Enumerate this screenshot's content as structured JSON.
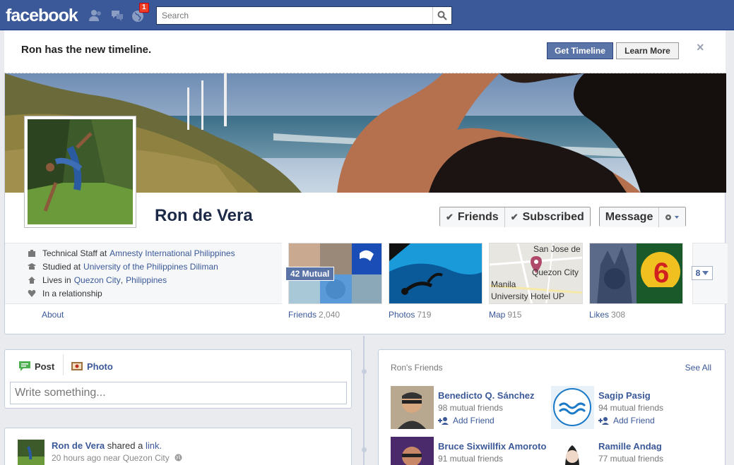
{
  "topbar": {
    "logo": "facebook",
    "notification_count": "1",
    "search_placeholder": "Search"
  },
  "banner": {
    "text": "Ron has the new timeline.",
    "get_timeline": "Get Timeline",
    "learn_more": "Learn More",
    "close": "×"
  },
  "profile": {
    "name": "Ron de Vera",
    "actions": {
      "friends": "Friends",
      "subscribed": "Subscribed",
      "message": "Message"
    },
    "info": [
      {
        "icon": "briefcase-icon",
        "prefix": "Technical Staff at",
        "link": "Amnesty International Philippines"
      },
      {
        "icon": "school-icon",
        "prefix": "Studied at",
        "link": "University of the Philippines Diliman"
      },
      {
        "icon": "home-icon",
        "prefix": "Lives in",
        "link": "Quezon City",
        "link2": "Philippines"
      },
      {
        "icon": "heart-icon",
        "prefix": "In a relationship"
      }
    ],
    "about": "About",
    "tiles": [
      {
        "label": "Friends",
        "count": "2,040",
        "overlay": "42 Mutual"
      },
      {
        "label": "Photos",
        "count": "719"
      },
      {
        "label": "Map",
        "count": "915",
        "map_labels": [
          "San Jose de",
          "Quezon City",
          "Manila",
          "University Hotel UP"
        ]
      },
      {
        "label": "Likes",
        "count": "308"
      }
    ],
    "more_count": "8"
  },
  "composer": {
    "post_tab": "Post",
    "photo_tab": "Photo",
    "placeholder": "Write something..."
  },
  "post": {
    "author": "Ron de Vera",
    "action": "shared a",
    "object": "link.",
    "meta": "20 hours ago near Quezon City"
  },
  "friends_box": {
    "title": "Ron's Friends",
    "see_all": "See All",
    "add_label": "Add Friend",
    "people": [
      {
        "name": "Benedicto Q. Sánchez",
        "mutual": "98 mutual friends"
      },
      {
        "name": "Sagip Pasig",
        "mutual": "94 mutual friends"
      },
      {
        "name": "Bruce Sixwillfix Amoroto",
        "mutual": "91 mutual friends"
      },
      {
        "name": "Ramille Andag",
        "mutual": "77 mutual friends"
      }
    ]
  },
  "colors": {
    "brand": "#3b5998",
    "brand_dark": "#29447e",
    "badge": "#f03d25",
    "page_bg": "#e9ebee"
  }
}
